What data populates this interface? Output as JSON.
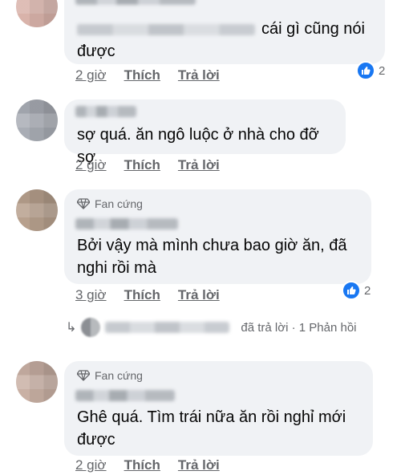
{
  "colors": {
    "bubble_bg": "#f0f2f5",
    "text": "#050505",
    "secondary_text": "#65676b",
    "like_blue": "#1877f2"
  },
  "comments": [
    {
      "badge": "",
      "text_visible": "cái gì cũng nói được",
      "text_line2": "được",
      "time": "2 giờ",
      "like": "Thích",
      "reply": "Trả lời",
      "reaction_count": "2",
      "reaction_icon": "like-icon"
    },
    {
      "badge": "",
      "text": "sợ quá. ăn ngô luộc ở nhà cho đỡ sợ",
      "time": "2 giờ",
      "like": "Thích",
      "reply": "Trả lời"
    },
    {
      "badge": "Fan cứng",
      "badge_icon": "diamond-icon",
      "text_line1": "Bởi vậy mà mình chưa bao giờ ăn, đã",
      "text_line2": "nghi rồi mà",
      "time": "3 giờ",
      "like": "Thích",
      "reply": "Trả lời",
      "reaction_count": "2",
      "reaction_icon": "like-icon"
    },
    {
      "badge": "Fan cứng",
      "badge_icon": "diamond-icon",
      "text_line1": "Ghê quá. Tìm trái nữa ăn rồi nghỉ mới",
      "text_line2": "được",
      "time": "2 giờ",
      "like": "Thích",
      "reply": "Trả lời"
    }
  ],
  "reply_summary": {
    "text": "đã trả lời · 1 Phản hồi"
  }
}
